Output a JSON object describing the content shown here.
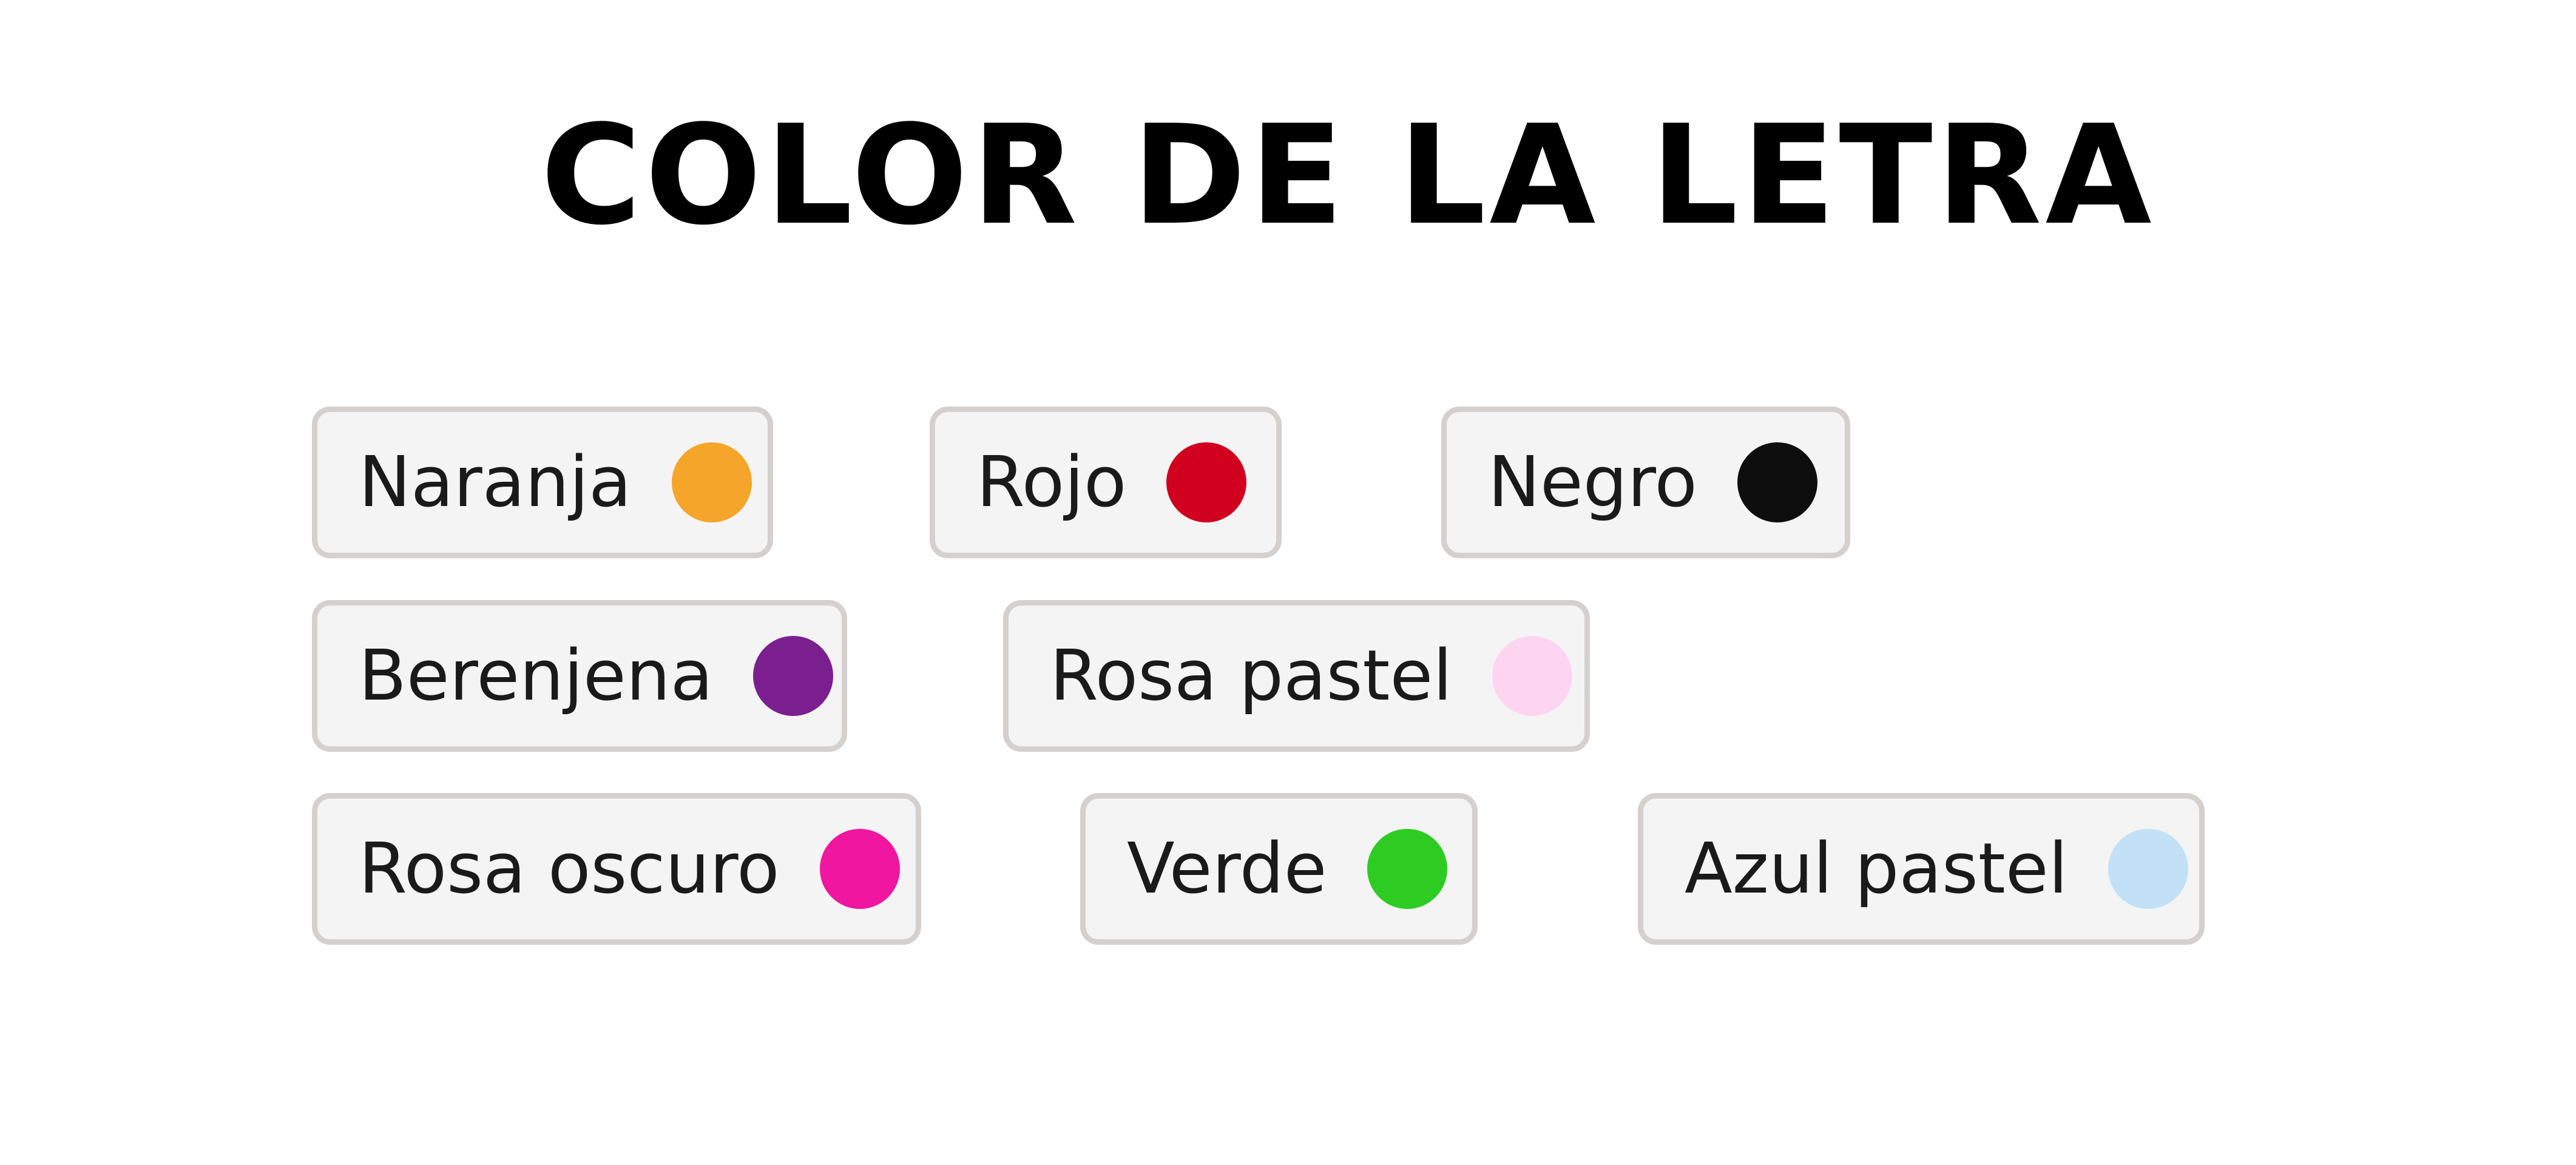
{
  "title": "COLOR DE LA LETRA",
  "options": [
    {
      "label": "Naranja",
      "color": "#f5a52a"
    },
    {
      "label": "Rojo",
      "color": "#d2001f"
    },
    {
      "label": "Negro",
      "color": "#0e0e0e"
    },
    {
      "label": "Berenjena",
      "color": "#7b1f8f"
    },
    {
      "label": "Rosa pastel",
      "color": "#fdd5f1"
    },
    {
      "label": "Rosa oscuro",
      "color": "#f0169f"
    },
    {
      "label": "Verde",
      "color": "#2ecc22"
    },
    {
      "label": "Azul pastel",
      "color": "#c2e1f6"
    }
  ]
}
